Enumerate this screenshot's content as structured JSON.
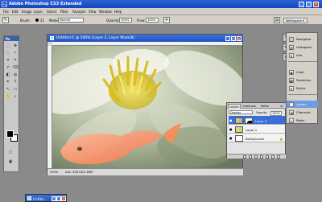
{
  "app": {
    "title": "Adobe Photoshop CS3 Extended",
    "badge": "Ps",
    "window_buttons": [
      "_",
      "□",
      "×"
    ]
  },
  "menu": [
    "File",
    "Edit",
    "Image",
    "Layer",
    "Select",
    "Filter",
    "Analysis",
    "View",
    "Window",
    "Help"
  ],
  "options_bar": {
    "brush_label": "Brush:",
    "brush_size": "21",
    "mode_label": "Mode:",
    "mode_value": "Normal",
    "opacity_label": "Opacity:",
    "opacity_value": "100%",
    "flow_label": "Flow:",
    "flow_value": "100%",
    "workspace_label": "Workspace ▾"
  },
  "toolbox": {
    "header": "Ps",
    "tools": [
      "⬚",
      "✥",
      "◌",
      "✧",
      "⌗",
      "✎",
      "✐",
      "⌫",
      "◧",
      "◍",
      "✒",
      "T",
      "↖",
      "▭",
      "✋",
      "⌕"
    ]
  },
  "document": {
    "title": "Untitled-1 @ 100% (Layer 2, Layer Mask/8)",
    "zoom": "100%",
    "doc_size": "Doc: 600.0K/1.65M"
  },
  "dock": {
    "items": [
      {
        "icon": "◫",
        "label": "Navigator"
      },
      {
        "icon": "▥",
        "label": "Histogram"
      },
      {
        "icon": "ℹ",
        "label": "Info"
      },
      {
        "icon": "◉",
        "label": "Color"
      },
      {
        "icon": "▦",
        "label": "Swatches"
      },
      {
        "icon": "✦",
        "label": "Styles"
      },
      {
        "icon": "◈",
        "label": "Layers"
      },
      {
        "icon": "◑",
        "label": "Channels"
      },
      {
        "icon": "◇",
        "label": "Paths"
      }
    ]
  },
  "layers_panel": {
    "tabs": [
      "Layers",
      "Channels",
      "Paths"
    ],
    "blend_mode": "Overlay",
    "opacity_label": "Opacity:",
    "opacity_value": "100%",
    "layers": [
      {
        "name": "Layer 2",
        "selected": true,
        "has_mask": true
      },
      {
        "name": "Layer 1",
        "selected": false,
        "has_mask": false
      },
      {
        "name": "Background",
        "selected": false,
        "has_mask": false
      }
    ]
  },
  "minimized_window": {
    "title": "Untitle..."
  },
  "colors": {
    "title_bar": "#2455c0",
    "panel_bg": "#d4d0c8",
    "workspace_bg": "#8a8a8a",
    "selected_layer": "#3a6fd9"
  }
}
